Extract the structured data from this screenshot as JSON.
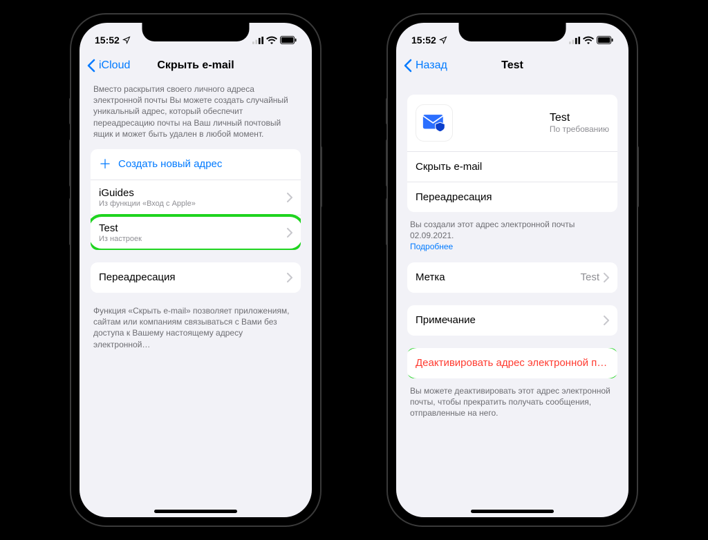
{
  "status": {
    "time": "15:52"
  },
  "left": {
    "back": "iCloud",
    "title": "Скрыть e-mail",
    "intro": "Вместо раскрытия своего личного адреса электронной почты Вы можете создать случайный уникальный адрес, который обеспечит переадресацию почты на Ваш личный почтовый ящик и может быть удален в любой момент.",
    "create": "Создать новый адрес",
    "items": [
      {
        "title": "iGuides",
        "sub": "Из функции «Вход с Apple»"
      },
      {
        "title": "Test",
        "sub": "Из настроек"
      }
    ],
    "forward": "Переадресация",
    "footer": "Функция «Скрыть e-mail» позволяет приложениям, сайтам или компаниям связываться с Вами без доступа к Вашему настоящему адресу электронной…"
  },
  "right": {
    "back": "Назад",
    "title": "Test",
    "card_title": "Test",
    "card_sub": "По требованию",
    "hide": "Скрыть e-mail",
    "forward": "Переадресация",
    "created": "Вы создали этот адрес электронной почты 02.09.2021.",
    "more": "Подробнее",
    "label_row": "Метка",
    "label_val": "Test",
    "note_row": "Примечание",
    "deactivate": "Деактивировать адрес электронной п…",
    "deactivate_note": "Вы можете деактивировать этот адрес электронной почты, чтобы прекратить получать сообщения, отправленные на него."
  }
}
